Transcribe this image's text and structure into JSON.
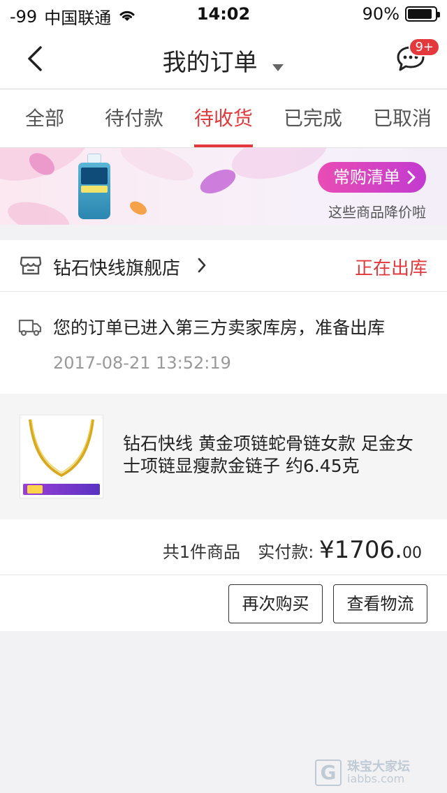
{
  "status_bar": {
    "signal": "-99",
    "carrier": "中国联通",
    "time": "14:02",
    "battery": "90%",
    "battery_level": 0.9
  },
  "nav": {
    "title": "我的订单",
    "message_badge": "9+"
  },
  "tabs": [
    {
      "label": "全部",
      "active": false
    },
    {
      "label": "待付款",
      "active": false
    },
    {
      "label": "待收货",
      "active": true
    },
    {
      "label": "已完成",
      "active": false
    },
    {
      "label": "已取消",
      "active": false
    }
  ],
  "banner": {
    "button_label": "常购清单",
    "subtitle": "这些商品降价啦",
    "button_color": "#e94cb4"
  },
  "order": {
    "shop_name": "钻石快线旗舰店",
    "status": "正在出库",
    "tracking_text": "您的订单已进入第三方卖家库房，准备出库",
    "tracking_time": "2017-08-21 13:52:19",
    "product_title": "钻石快线 黄金项链蛇骨链女款 足金女士项链显瘦款金链子 约6.45克",
    "total_label": "共1件商品",
    "paid_label": "实付款:",
    "price_symbol": "¥",
    "price_int": "1706.",
    "price_dec": "00",
    "actions": {
      "rebuy": "再次购买",
      "logistics": "查看物流"
    }
  },
  "watermark": {
    "mark": "G",
    "site_name": "珠宝大家坛",
    "url": "iabbs.com"
  },
  "colors": {
    "accent": "#e4393c",
    "background": "#f2f2f4"
  }
}
